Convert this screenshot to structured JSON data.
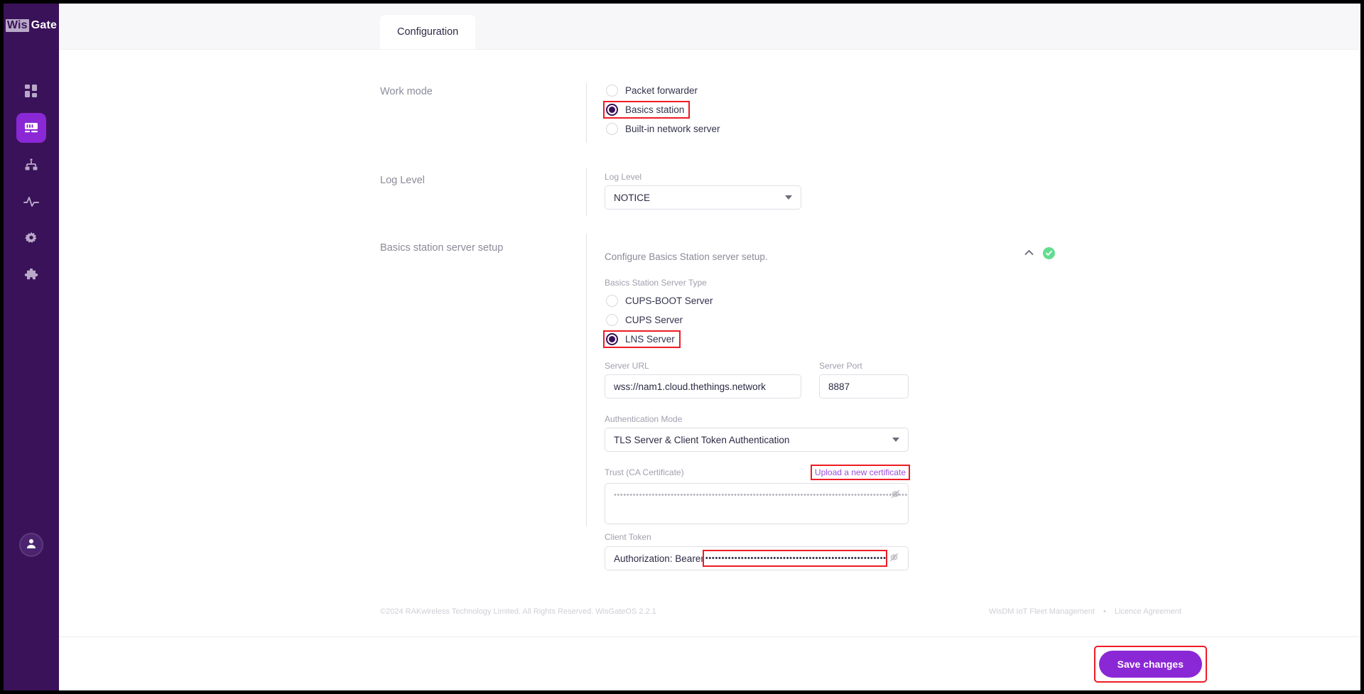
{
  "brand": {
    "prefix": "Wis",
    "suffix": "Gate"
  },
  "sidebar": {
    "items": [
      {
        "name": "dashboard",
        "icon": "grid-icon"
      },
      {
        "name": "gateway",
        "icon": "gateway-icon",
        "active": true
      },
      {
        "name": "network",
        "icon": "network-icon"
      },
      {
        "name": "activity",
        "icon": "activity-icon"
      },
      {
        "name": "settings",
        "icon": "gear-icon"
      },
      {
        "name": "plugins",
        "icon": "puzzle-icon"
      }
    ],
    "avatar_icon": "user-avatar-icon"
  },
  "tabs": [
    {
      "label": "Configuration",
      "active": true
    }
  ],
  "work_mode": {
    "section_label": "Work mode",
    "options": [
      {
        "label": "Packet forwarder",
        "selected": false,
        "highlighted": false
      },
      {
        "label": "Basics station",
        "selected": true,
        "highlighted": true
      },
      {
        "label": "Built-in network server",
        "selected": false,
        "highlighted": false
      }
    ]
  },
  "log_level": {
    "section_label": "Log Level",
    "field_label": "Log Level",
    "value": "NOTICE"
  },
  "basics_station": {
    "section_label": "Basics station server setup",
    "description": "Configure Basics Station server setup.",
    "collapse_icon": "chevron-up-icon",
    "status_icon": "check-circle-icon",
    "server_type": {
      "label": "Basics Station Server Type",
      "options": [
        {
          "label": "CUPS-BOOT Server",
          "selected": false,
          "highlighted": false
        },
        {
          "label": "CUPS Server",
          "selected": false,
          "highlighted": false
        },
        {
          "label": "LNS Server",
          "selected": true,
          "highlighted": true
        }
      ]
    },
    "server_url": {
      "label": "Server URL",
      "value": "wss://nam1.cloud.thethings.network",
      "placeholder": "Server URL"
    },
    "server_port": {
      "label": "Server Port",
      "value": "8887",
      "placeholder": "Server Port"
    },
    "auth_mode": {
      "label": "Authentication Mode",
      "value": "TLS Server & Client Token Authentication"
    },
    "trust_ca": {
      "label": "Trust (CA Certificate)",
      "upload_link": "Upload a new certificate",
      "masked_value": "••••••••••••••••••••••••••••••••••••••••••••••••••••••••••••••••••••••••••••••••••••••••••••••••••••••••••••••••••••••••••••••••••",
      "toggle_icon": "eye-off-icon"
    },
    "client_token": {
      "label": "Client Token",
      "prefix": "Authorization: Bearer",
      "masked_value": "•••••••••••••••••••••••••••••••••••••••••••••••••••••••••••••••••••••••••••",
      "toggle_icon": "eye-off-icon"
    }
  },
  "footer": {
    "copyright": "©2024 RAKwireless Technology Limited. All Rights Reserved. WisGateOS 2.2.1",
    "link_fleet": "WisDM IoT Fleet Management",
    "separator": "•",
    "link_licence": "Licence Agreement"
  },
  "actions": {
    "save_label": "Save changes"
  },
  "colors": {
    "sidebar_bg": "#3a1259",
    "accent": "#8b28d6",
    "highlight_box": "#ee1c25",
    "link": "#9b4ddb",
    "status_ok": "#62dd8f"
  }
}
